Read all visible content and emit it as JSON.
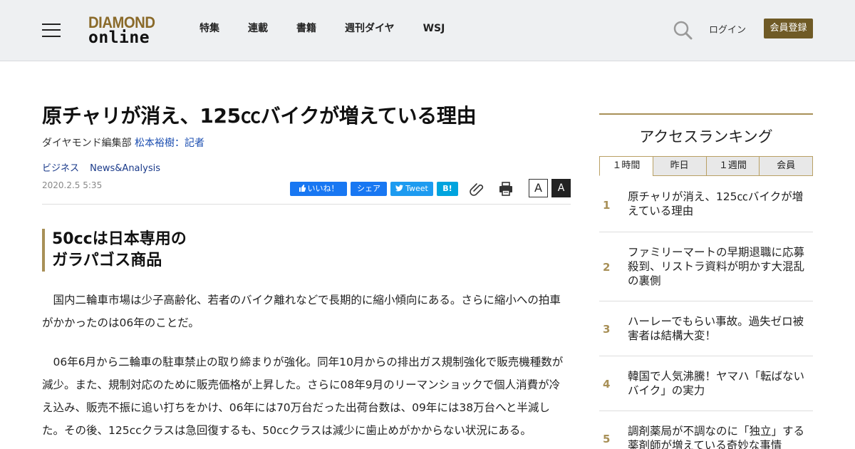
{
  "header": {
    "logo_line1": "DIAMOND",
    "logo_line2": "online",
    "nav": [
      "特集",
      "連載",
      "書籍",
      "週刊ダイヤ",
      "WSJ"
    ],
    "login": "ログイン",
    "register": "会員登録",
    "accent_color": "#6f5a26"
  },
  "article": {
    "title": "原チャリが消え、125㏄バイクが増えている理由",
    "author_prefix": "ダイヤモンド編集部 ",
    "author_name": "松本裕樹：記者",
    "tags": [
      "ビジネス",
      "News&Analysis"
    ],
    "date": "2020.2.5 5:35",
    "share": {
      "like": "いいね！",
      "fb_share": "シェア",
      "tweet": "Tweet",
      "hatena": "B!"
    },
    "font_small": "A",
    "font_large": "A",
    "subheading_line1": "50ccは日本専用の",
    "subheading_line2": "ガラパゴス商品",
    "paragraph1": "　国内二輪車市場は少子高齢化、若者のバイク離れなどで長期的に縮小傾向にある。さらに縮小への拍車がかかったのは06年のことだ。",
    "paragraph2": "　06年6月から二輪車の駐車禁止の取り締まりが強化。同年10月からの排出ガス規制強化で販売機種数が減少。また、規制対応のために販売価格が上昇した。さらに08年9月のリーマンショックで個人消費が冷え込み、販売不振に追い打ちをかけ、06年には70万台だった出荷台数は、09年には38万台へと半減した。その後、125ccクラスは急回復するも、50ccクラスは減少に歯止めがかからない状況にある。"
  },
  "sidebar": {
    "title": "アクセスランキング",
    "tabs": [
      "１時間",
      "昨日",
      "１週間",
      "会員"
    ],
    "active_tab": "１時間",
    "rankings": [
      {
        "rank": "1",
        "title": "原チャリが消え、125㏄バイクが増えている理由"
      },
      {
        "rank": "2",
        "title": "ファミリーマートの早期退職に応募殺到、リストラ資料が明かす大混乱の裏側"
      },
      {
        "rank": "3",
        "title": "ハーレーでもらい事故。過失ゼロ被害者は結構大変！"
      },
      {
        "rank": "4",
        "title": "韓国で人気沸騰！ヤマハ「転ばないバイク」の実力"
      },
      {
        "rank": "5",
        "title": "調剤薬局が不調なのに「独立」する薬剤師が増えている奇妙な事情"
      }
    ]
  }
}
